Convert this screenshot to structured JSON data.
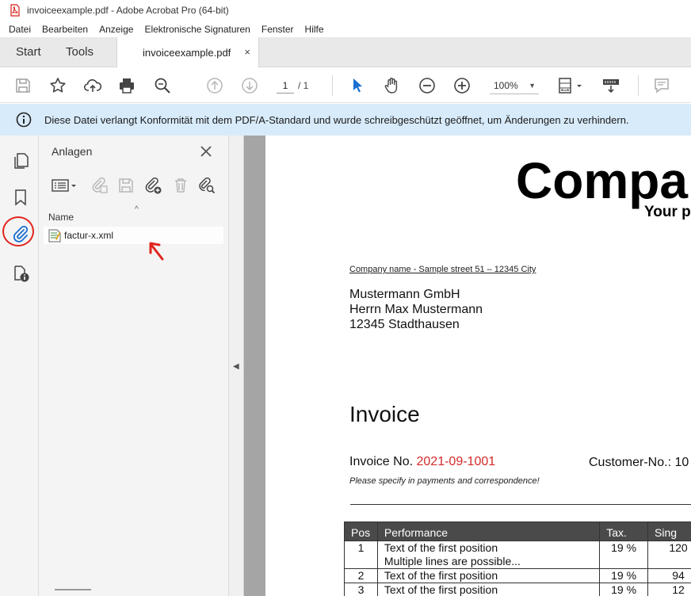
{
  "window": {
    "title": "invoiceexample.pdf - Adobe Acrobat Pro (64-bit)"
  },
  "menu": [
    "Datei",
    "Bearbeiten",
    "Anzeige",
    "Elektronische Signaturen",
    "Fenster",
    "Hilfe"
  ],
  "tabs": {
    "start": "Start",
    "tools": "Tools",
    "document": "invoiceexample.pdf",
    "close": "×"
  },
  "toolbar": {
    "icons": [
      "save-icon",
      "star-icon",
      "upload-icon",
      "print-icon",
      "zoom-search-icon",
      "page-up-icon",
      "page-down-icon",
      "select-arrow-icon",
      "hand-icon",
      "zoom-out-icon",
      "zoom-in-icon",
      "fit-page-icon",
      "scroll-mode-icon",
      "comment-icon"
    ],
    "page_current": "1",
    "page_total": "/ 1",
    "zoom": "100%"
  },
  "banner": {
    "message": "Diese Datei verlangt Konformität mit dem PDF/A-Standard und wurde schreibgeschützt geöffnet, um Änderungen zu verhindern."
  },
  "rail": {
    "icons": [
      "pages-icon",
      "bookmark-icon",
      "attachment-icon",
      "document-properties-icon"
    ]
  },
  "attachments": {
    "title": "Anlagen",
    "column_name": "Name",
    "files": [
      {
        "name": "factur-x.xml"
      }
    ]
  },
  "accent": {
    "highlight_red": "#e0241d",
    "info_blue": "#d8ebfa"
  },
  "pdf": {
    "company": "Compa",
    "tagline": "Your p",
    "sender_line": "Company name - Sample street 51 – 12345 City",
    "address": [
      "Mustermann GmbH",
      "Herrn Max Mustermann",
      "12345 Stadthausen"
    ],
    "invoice_title": "Invoice",
    "invoice_no_label": "Invoice No.",
    "invoice_no": "2021-09-1001",
    "customer_no_label": "Customer-No.: 10",
    "note": "Please specify in payments and correspondence!",
    "table": {
      "headers": [
        "Pos",
        "Performance",
        "Tax.",
        "Sing"
      ],
      "rows": [
        {
          "pos": "1",
          "perf": "Text of the first position",
          "perf2": "Multiple lines are possible...",
          "tax": "19 %",
          "single": "120"
        },
        {
          "pos": "2",
          "perf": "Text of the first position",
          "perf2": "",
          "tax": "19 %",
          "single": "94"
        },
        {
          "pos": "3",
          "perf": "Text of the first position",
          "perf2": "",
          "tax": "19 %",
          "single": "12"
        }
      ]
    }
  }
}
